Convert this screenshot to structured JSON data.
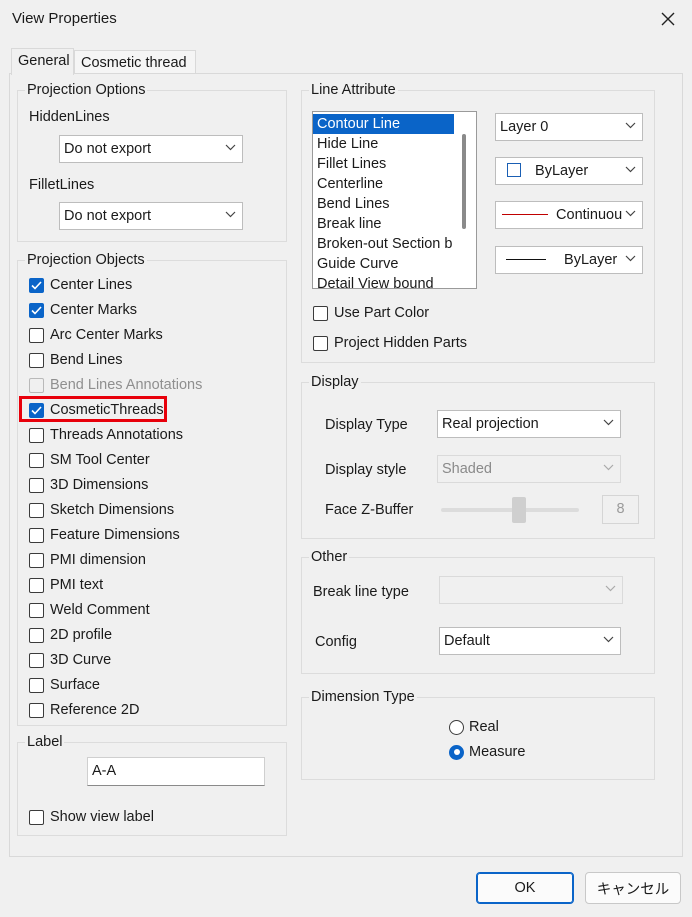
{
  "window": {
    "title": "View Properties"
  },
  "tabs": [
    {
      "label": "General"
    },
    {
      "label": "Cosmetic thread"
    }
  ],
  "projection_options": {
    "title": "Projection Options",
    "hidden_lines_label": "HiddenLines",
    "hidden_lines_value": "Do not export",
    "fillet_lines_label": "FilletLines",
    "fillet_lines_value": "Do not export"
  },
  "projection_objects": {
    "title": "Projection Objects",
    "items": [
      {
        "label": "Center Lines",
        "checked": true,
        "disabled": false
      },
      {
        "label": "Center Marks",
        "checked": true,
        "disabled": false
      },
      {
        "label": "Arc Center Marks",
        "checked": false,
        "disabled": false
      },
      {
        "label": "Bend Lines",
        "checked": false,
        "disabled": false
      },
      {
        "label": "Bend Lines Annotations",
        "checked": false,
        "disabled": true
      },
      {
        "label": "CosmeticThreads",
        "checked": true,
        "disabled": false
      },
      {
        "label": "Threads Annotations",
        "checked": false,
        "disabled": false
      },
      {
        "label": "SM Tool Center",
        "checked": false,
        "disabled": false
      },
      {
        "label": "3D Dimensions",
        "checked": false,
        "disabled": false
      },
      {
        "label": "Sketch Dimensions",
        "checked": false,
        "disabled": false
      },
      {
        "label": "Feature Dimensions",
        "checked": false,
        "disabled": false
      },
      {
        "label": "PMI dimension",
        "checked": false,
        "disabled": false
      },
      {
        "label": "PMI text",
        "checked": false,
        "disabled": false
      },
      {
        "label": "Weld Comment",
        "checked": false,
        "disabled": false
      },
      {
        "label": "2D profile",
        "checked": false,
        "disabled": false
      },
      {
        "label": "3D Curve",
        "checked": false,
        "disabled": false
      },
      {
        "label": "Surface",
        "checked": false,
        "disabled": false
      },
      {
        "label": "Reference 2D",
        "checked": false,
        "disabled": false
      }
    ]
  },
  "label_group": {
    "title": "Label",
    "value": "A-A",
    "show_view_label": "Show view label"
  },
  "line_attribute": {
    "title": "Line Attribute",
    "list": [
      "Contour Line",
      "Hide Line",
      "Fillet Lines",
      "Centerline",
      "Bend Lines",
      "Break line",
      "Broken-out Section b",
      "Guide Curve",
      "Detail View bound"
    ],
    "selected_index": 0,
    "layer": "Layer 0",
    "color": "ByLayer",
    "linetype": "Continuou",
    "lineweight": "ByLayer",
    "use_part_color": "Use Part Color",
    "project_hidden_parts": "Project Hidden Parts"
  },
  "display": {
    "title": "Display",
    "type_label": "Display Type",
    "type_value": "Real projection",
    "style_label": "Display style",
    "style_value": "Shaded",
    "zbuffer_label": "Face Z-Buffer",
    "zbuffer_value": "8"
  },
  "other": {
    "title": "Other",
    "break_label": "Break line type",
    "break_value": "",
    "config_label": "Config",
    "config_value": "Default"
  },
  "dimension_type": {
    "title": "Dimension Type",
    "options": [
      {
        "label": "Real",
        "selected": false
      },
      {
        "label": "Measure",
        "selected": true
      }
    ]
  },
  "buttons": {
    "ok": "OK",
    "cancel": "キャンセル"
  },
  "colors": {
    "accent": "#0a64c8",
    "highlight": "#e8000b",
    "linetype_red": "#c00000"
  }
}
